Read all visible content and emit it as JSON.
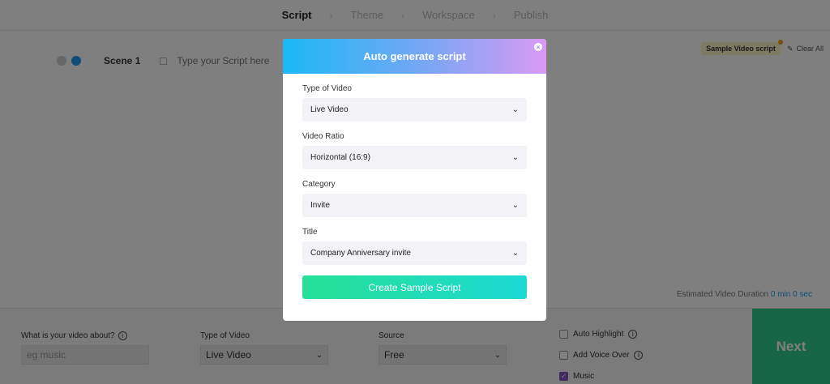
{
  "nav": {
    "steps": [
      "Script",
      "Theme",
      "Workspace",
      "Publish"
    ],
    "separator": "›"
  },
  "scene": {
    "label": "Scene 1",
    "placeholder": "Type your Script here"
  },
  "tools": {
    "sample_label": "Sample Video script",
    "clear_label": "Clear All"
  },
  "duration": {
    "label": "Estimated Video Duration",
    "value": "0 min 0 sec"
  },
  "bottom": {
    "about_label": "What is your video about?",
    "about_placeholder": "eg music",
    "type_label": "Type of Video",
    "type_value": "Live Video",
    "source_label": "Source",
    "source_value": "Free",
    "checks": [
      {
        "label": "Auto Highlight",
        "checked": false
      },
      {
        "label": "Add Voice Over",
        "checked": false
      },
      {
        "label": "Music",
        "checked": true
      }
    ],
    "next_label": "Next"
  },
  "modal": {
    "title": "Auto generate script",
    "close_glyph": "×",
    "fields": [
      {
        "label": "Type of Video",
        "value": "Live Video"
      },
      {
        "label": "Video Ratio",
        "value": "Horizontal (16:9)"
      },
      {
        "label": "Category",
        "value": "Invite"
      },
      {
        "label": "Title",
        "value": "Company Anniversary invite"
      }
    ],
    "create_label": "Create Sample Script"
  },
  "colors": {
    "accent_blue": "#1e9bf0",
    "next_green": "#2ecc8f",
    "check_purple": "#7e57c2"
  }
}
